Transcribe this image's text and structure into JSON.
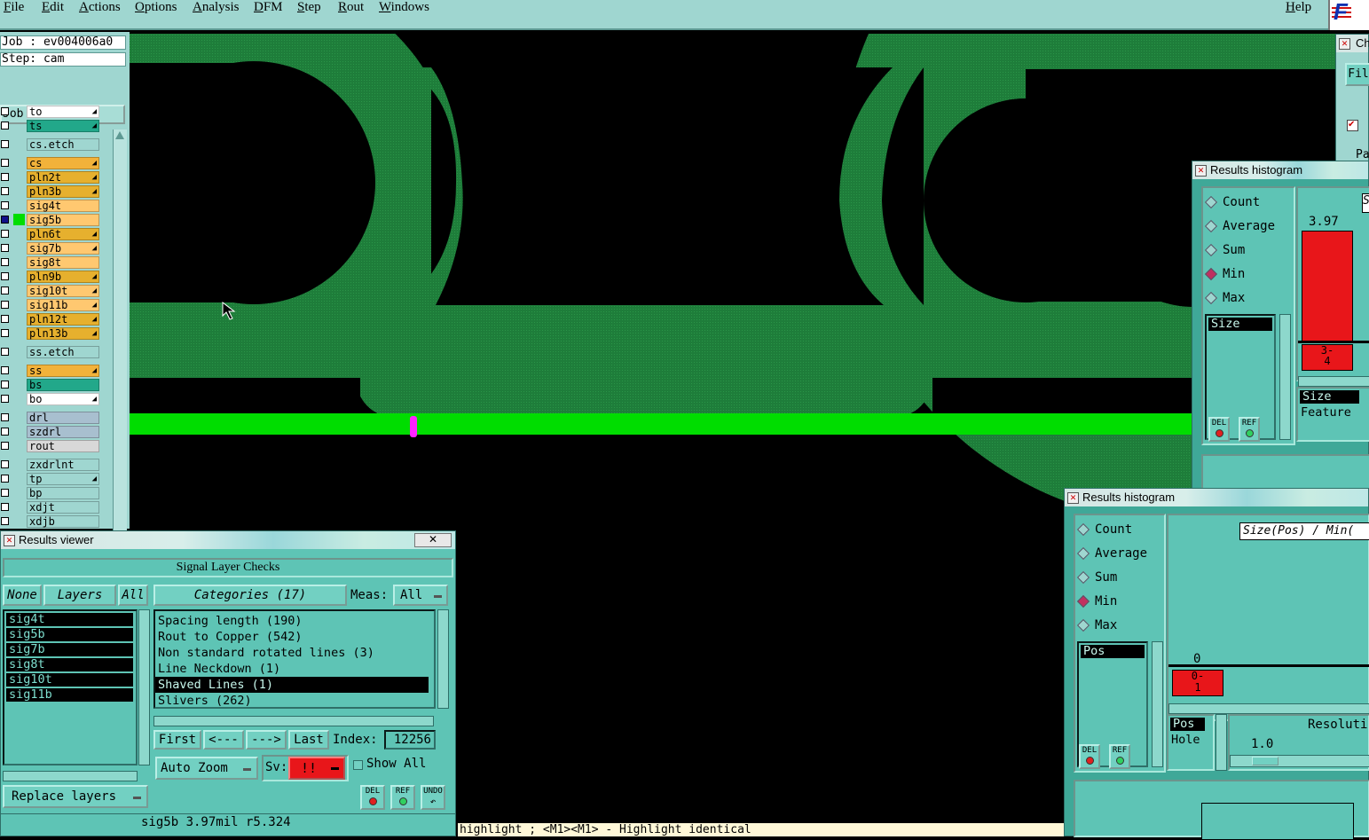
{
  "menu": {
    "file": "File",
    "edit": "Edit",
    "actions": "Actions",
    "options": "Options",
    "analysis": "Analysis",
    "dfm": "DFM",
    "step": "Step",
    "rout": "Rout",
    "windows": "Windows",
    "help": "Help"
  },
  "brand": "F",
  "job": {
    "job_label": "Job : ev004006a0",
    "step_label": "Step: cam",
    "matrix_btn": "Job Matrix ..."
  },
  "layers": [
    {
      "name": "to",
      "color": "#ffffff",
      "mark": true
    },
    {
      "name": "ts",
      "color": "#22a88a",
      "mark": true
    },
    {
      "name": "cs.etch",
      "color": "#9fd6d0",
      "mark": false,
      "wide": true
    },
    {
      "name": "cs",
      "color": "#f2b23a",
      "mark": true
    },
    {
      "name": "pln2t",
      "color": "#e6b02e",
      "mark": true
    },
    {
      "name": "pln3b",
      "color": "#e6b02e",
      "mark": true
    },
    {
      "name": "sig4t",
      "color": "#ffc870",
      "mark": false
    },
    {
      "name": "sig5b",
      "color": "#ffc870",
      "mark": false,
      "active": true
    },
    {
      "name": "pln6t",
      "color": "#e6b02e",
      "mark": true
    },
    {
      "name": "sig7b",
      "color": "#ffc870",
      "mark": true
    },
    {
      "name": "sig8t",
      "color": "#ffc870",
      "mark": false
    },
    {
      "name": "pln9b",
      "color": "#e6b02e",
      "mark": true
    },
    {
      "name": "sig10t",
      "color": "#ffc870",
      "mark": true
    },
    {
      "name": "sig11b",
      "color": "#ffc870",
      "mark": true
    },
    {
      "name": "pln12t",
      "color": "#e6b02e",
      "mark": true
    },
    {
      "name": "pln13b",
      "color": "#e6b02e",
      "mark": true
    },
    {
      "name": "ss.etch",
      "color": "#9fd6d0",
      "mark": false,
      "wide": true
    },
    {
      "name": "ss",
      "color": "#f2b23a",
      "mark": true
    },
    {
      "name": "bs",
      "color": "#22a88a",
      "mark": false
    },
    {
      "name": "bo",
      "color": "#ffffff",
      "mark": true
    },
    {
      "name": "drl",
      "color": "#a8bfcf",
      "mark": false
    },
    {
      "name": "szdrl",
      "color": "#a8bfcf",
      "mark": false
    },
    {
      "name": "rout",
      "color": "#d8d8d8",
      "mark": false
    },
    {
      "name": "zxdrlnt",
      "color": "#9fd6d0",
      "mark": false
    },
    {
      "name": "tp",
      "color": "#9fd6d0",
      "mark": true
    },
    {
      "name": "bp",
      "color": "#9fd6d0",
      "mark": false
    },
    {
      "name": "xdjt",
      "color": "#9fd6d0",
      "mark": false
    },
    {
      "name": "xdjb",
      "color": "#9fd6d0",
      "mark": false
    }
  ],
  "results_viewer": {
    "title": "Results viewer",
    "header": "Signal Layer Checks",
    "btn_none": "None",
    "btn_layers": "Layers",
    "btn_all": "All",
    "layer_list": [
      "sig4t",
      "sig5b",
      "sig7b",
      "sig8t",
      "sig10t",
      "sig11b"
    ],
    "categories_label": "Categories (17)",
    "meas_label": "Meas:",
    "meas_value": "All",
    "categories": [
      "Spacing length (190)",
      "Rout to Copper (542)",
      "Non standard rotated lines (3)",
      "Line Neckdown (1)",
      "Shaved Lines (1)",
      "Slivers (262)"
    ],
    "selected_category": 4,
    "nav": {
      "first": "First",
      "prev": "<---",
      "next": "--->",
      "last": "Last",
      "index_label": "Index:",
      "index_value": "12256"
    },
    "auto_zoom": "Auto Zoom",
    "sv_label": "Sv:",
    "sv_value": "!!",
    "show_all": "Show All",
    "replace_layers": "Replace layers",
    "icons": {
      "del": "DEL",
      "ref": "REF",
      "undo": "UNDO"
    },
    "status": "sig5b 3.97mil  r5.324"
  },
  "histogram_top": {
    "title": "Results histogram",
    "options": [
      "Count",
      "Average",
      "Sum",
      "Min",
      "Max"
    ],
    "selected": "Min",
    "field": "Size",
    "bar_value": "3.97",
    "bin_label": "3-\n4",
    "attr_list": [
      "Size",
      "Feature"
    ],
    "cut_label": "S"
  },
  "histogram_bottom": {
    "title": "Results histogram",
    "options": [
      "Count",
      "Average",
      "Sum",
      "Min",
      "Max"
    ],
    "selected": "Min",
    "field": "Pos",
    "chart_title": "Size(Pos) / Min(",
    "bar_value": "0",
    "bin_label": "0-\n1",
    "attr_list": [
      "Pos",
      "Hole"
    ],
    "resolution_label": "Resoluti",
    "resolution_value": "1.0"
  },
  "status_bar": "highlight ; <M1><M1> - Highlight identical",
  "right_edge": {
    "title": "Ch",
    "file": "Fil",
    "pa": "Pa"
  },
  "colors": {
    "trace": "#1e7d3a",
    "bright": "#00dd00",
    "marker": "#ff00ff",
    "panel": "#5ec4b5",
    "menubar": "#9fd6d0"
  }
}
